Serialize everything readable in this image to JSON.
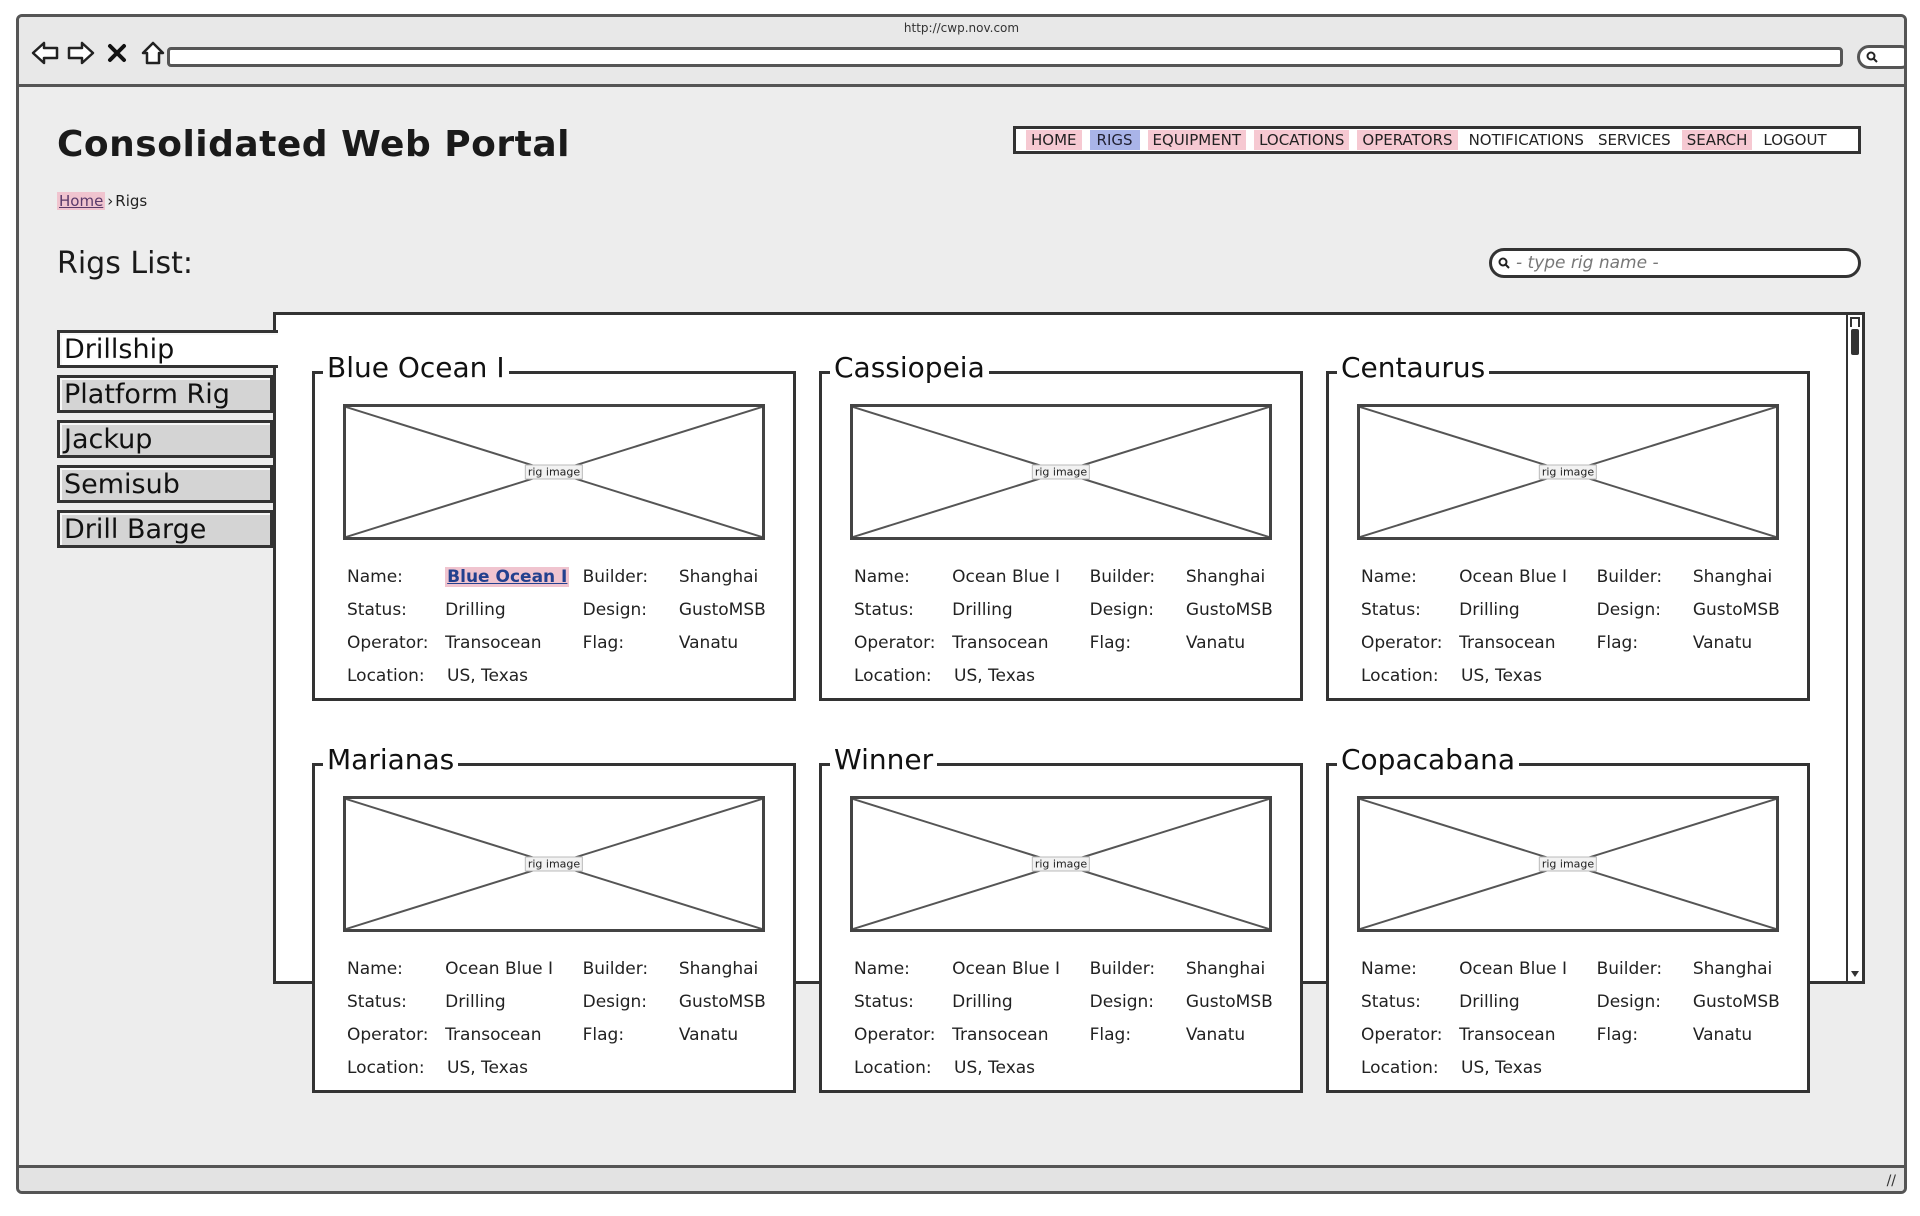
{
  "browser": {
    "url": "http://cwp.nov.com"
  },
  "header": {
    "title": "Consolidated Web Portal"
  },
  "breadcrumb": {
    "home": "Home",
    "separator": "›",
    "current": "Rigs"
  },
  "nav": {
    "items": [
      {
        "label": "HOME",
        "state": "link"
      },
      {
        "label": "RIGS",
        "state": "active"
      },
      {
        "label": "EQUIPMENT",
        "state": "link"
      },
      {
        "label": "LOCATIONS",
        "state": "link"
      },
      {
        "label": "OPERATORS",
        "state": "link"
      },
      {
        "label": "NOTIFICATIONS",
        "state": "plain"
      },
      {
        "label": "SERVICES",
        "state": "plain"
      },
      {
        "label": "SEARCH",
        "state": "link"
      },
      {
        "label": "LOGOUT",
        "state": "plain"
      }
    ]
  },
  "rigs_list_label": "Rigs List:",
  "search": {
    "placeholder": "- type rig name -"
  },
  "tabs": [
    "Drillship",
    "Platform Rig",
    "Jackup",
    "Semisub",
    "Drill Barge"
  ],
  "field_labels": {
    "name": "Name:",
    "status": "Status:",
    "operator": "Operator:",
    "location": "Location:",
    "builder": "Builder:",
    "design": "Design:",
    "flag": "Flag:"
  },
  "image_label": "rig image",
  "cards": [
    {
      "title": "Blue Ocean I",
      "name": "Blue Ocean I",
      "status": "Drilling",
      "operator": "Transocean",
      "location": "US, Texas",
      "builder": "Shanghai",
      "design": "GustoMSB",
      "flag": "Vanatu"
    },
    {
      "title": "Cassiopeia",
      "name": "Ocean Blue I",
      "status": "Drilling",
      "operator": "Transocean",
      "location": "US, Texas",
      "builder": "Shanghai",
      "design": "GustoMSB",
      "flag": "Vanatu"
    },
    {
      "title": "Centaurus",
      "name": "Ocean Blue I",
      "status": "Drilling",
      "operator": "Transocean",
      "location": "US, Texas",
      "builder": "Shanghai",
      "design": "GustoMSB",
      "flag": "Vanatu"
    },
    {
      "title": "Marianas",
      "name": "Ocean Blue I",
      "status": "Drilling",
      "operator": "Transocean",
      "location": "US, Texas",
      "builder": "Shanghai",
      "design": "GustoMSB",
      "flag": "Vanatu"
    },
    {
      "title": "Winner",
      "name": "Ocean Blue I",
      "status": "Drilling",
      "operator": "Transocean",
      "location": "US, Texas",
      "builder": "Shanghai",
      "design": "GustoMSB",
      "flag": "Vanatu"
    },
    {
      "title": "Copacabana",
      "name": "Ocean Blue I",
      "status": "Drilling",
      "operator": "Transocean",
      "location": "US, Texas",
      "builder": "Shanghai",
      "design": "GustoMSB",
      "flag": "Vanatu"
    }
  ],
  "colors": {
    "link_highlight": "#f6c9d2",
    "active_highlight": "#a9b4e8",
    "link_text": "#23408e"
  }
}
